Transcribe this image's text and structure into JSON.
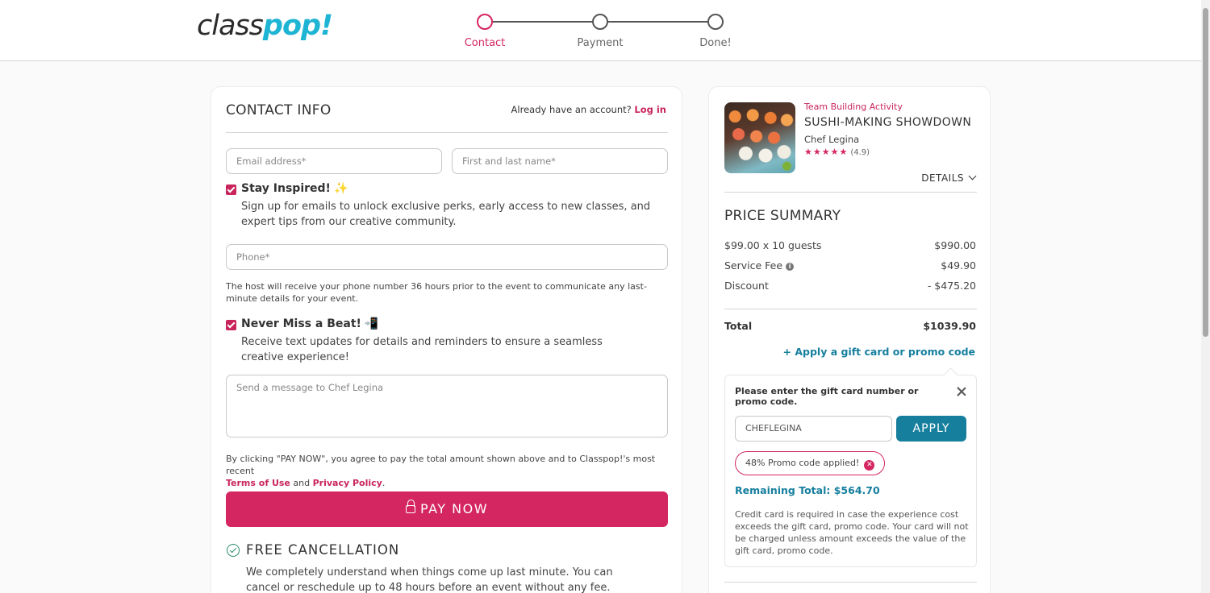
{
  "brand": {
    "logo_part1": "class",
    "logo_part2": "pop!"
  },
  "steps": [
    {
      "label": "Contact"
    },
    {
      "label": "Payment"
    },
    {
      "label": "Done!"
    }
  ],
  "contact": {
    "title": "CONTACT INFO",
    "account_prompt": "Already have an account?",
    "login_label": "Log in",
    "email_placeholder": "Email address*",
    "name_placeholder": "First and last name*",
    "stay_inspired": {
      "title": "Stay Inspired!",
      "emoji": "✨",
      "desc": "Sign up for emails to unlock exclusive perks, early access to new classes, and expert tips from our creative community."
    },
    "phone_placeholder": "Phone*",
    "phone_note": "The host will receive your phone number 36 hours prior to the event to communicate any last-minute details for your event.",
    "never_miss": {
      "title": "Never Miss a Beat!",
      "emoji": "📲",
      "desc": "Receive text updates for details and reminders to ensure a seamless creative experience!"
    },
    "message_placeholder": "Send a message to Chef Legina",
    "terms_prefix": "By clicking \"PAY NOW\", you agree to pay the total amount shown above and to Classpop!'s most recent",
    "terms_link": "Terms of Use",
    "and": "and",
    "privacy_link": "Privacy Policy",
    "period": ".",
    "pay_label": "PAY NOW",
    "free_cancel_title": "FREE CANCELLATION",
    "free_cancel_desc": "We completely understand when things come up last minute. You can cancel or reschedule up to 48 hours before an event without any fee."
  },
  "summary": {
    "category": "Team Building Activity",
    "class_title": "SUSHI-MAKING SHOWDOWN",
    "chef": "Chef Legina",
    "stars": "★★★★★",
    "rating": "(4.9)",
    "details_label": "DETAILS",
    "price_title": "PRICE SUMMARY",
    "rows": [
      {
        "label": "$99.00 x 10 guests",
        "value": "$990.00"
      },
      {
        "label": "Service Fee",
        "value": "$49.90"
      },
      {
        "label": "Discount",
        "value": "- $475.20"
      }
    ],
    "total_label": "Total",
    "total_value": "$1039.90",
    "promo_link": "+ Apply a gift card or promo code",
    "popover": {
      "title": "Please enter the gift card number or promo code.",
      "code_value": "CHEFLEGINA",
      "apply_label": "APPLY",
      "chip_label": "48% Promo code applied!",
      "remaining": "Remaining Total: $564.70",
      "note": "Credit card is required in case the experience cost exceeds the gift card, promo code. Your card will not be charged unless amount exceeds the value of the gift card, promo code."
    }
  },
  "colors": {
    "accent": "#d42660",
    "teal": "#167f9e",
    "brand_cyan": "#1eb4d3"
  }
}
